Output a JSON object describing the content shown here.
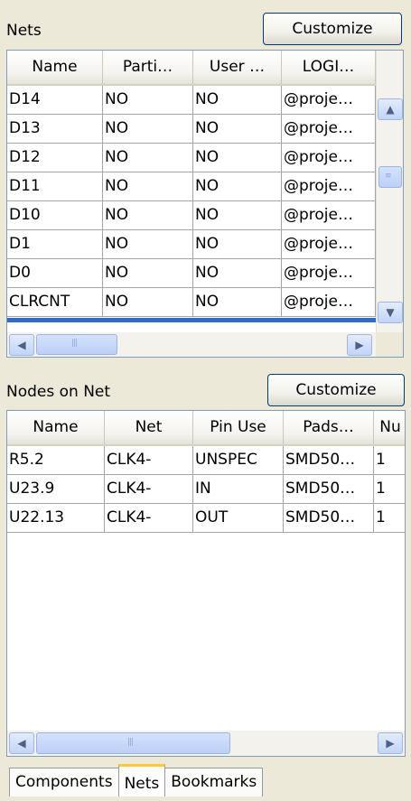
{
  "nets_panel": {
    "title": "Nets",
    "customize_label": "Customize",
    "columns": [
      "Name",
      "Parti…",
      "User …",
      "LOGI…"
    ],
    "rows": [
      [
        "D14",
        "NO",
        "NO",
        "@proje…"
      ],
      [
        "D13",
        "NO",
        "NO",
        "@proje…"
      ],
      [
        "D12",
        "NO",
        "NO",
        "@proje…"
      ],
      [
        "D11",
        "NO",
        "NO",
        "@proje…"
      ],
      [
        "D10",
        "NO",
        "NO",
        "@proje…"
      ],
      [
        "D1",
        "NO",
        "NO",
        "@proje…"
      ],
      [
        "D0",
        "NO",
        "NO",
        "@proje…"
      ],
      [
        "CLRCNT",
        "NO",
        "NO",
        "@proje…"
      ]
    ],
    "icons": {
      "scroll_up": "scroll-up-arrow-icon",
      "scroll_down": "scroll-down-arrow-icon",
      "scroll_left": "scroll-left-arrow-icon",
      "scroll_right": "scroll-right-arrow-icon"
    }
  },
  "nodes_panel": {
    "title": "Nodes on Net",
    "customize_label": "Customize",
    "columns": [
      "Name",
      "Net",
      "Pin Use",
      "Pads…",
      "Nu"
    ],
    "rows": [
      [
        "R5.2",
        "CLK4-",
        "UNSPEC",
        "SMD50…",
        "1"
      ],
      [
        "U23.9",
        "CLK4-",
        "IN",
        "SMD50…",
        "1"
      ],
      [
        "U22.13",
        "CLK4-",
        "OUT",
        "SMD50…",
        "1"
      ]
    ]
  },
  "tabs": [
    {
      "label": "Components",
      "active": false
    },
    {
      "label": "Nets",
      "active": true
    },
    {
      "label": "Bookmarks",
      "active": false
    }
  ],
  "colors": {
    "background": "#ece9d8",
    "selection_bar": "#316ac5",
    "active_tab_accent": "#ffc83c",
    "grid_border": "#7f9db9"
  }
}
